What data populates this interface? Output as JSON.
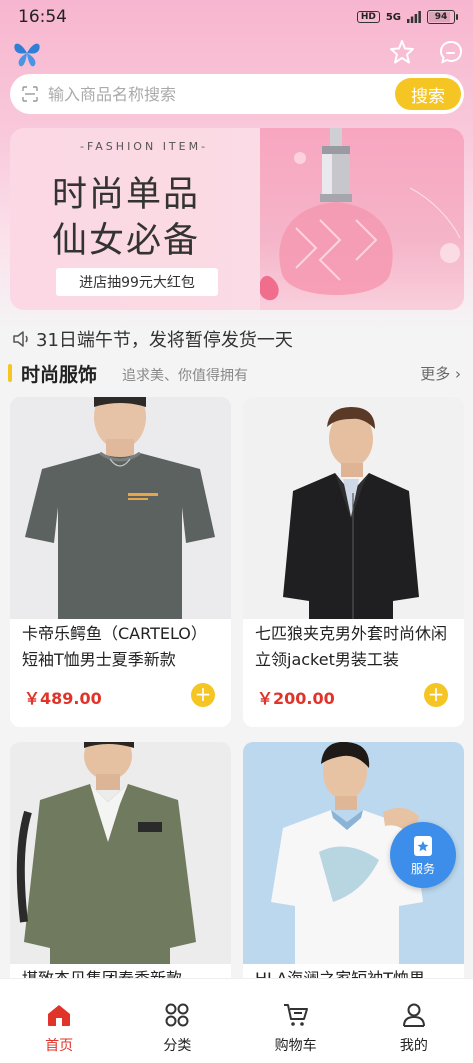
{
  "status_bar": {
    "time": "16:54",
    "network": "5G",
    "hd": "HD",
    "battery": "94"
  },
  "header": {
    "logo_icon": "butterfly-icon",
    "favorite_icon": "star-icon",
    "message_icon": "chat-icon"
  },
  "search": {
    "placeholder": "输入商品名称搜索",
    "button_label": "搜索",
    "scan_icon": "scan-icon"
  },
  "banner": {
    "subtitle": "-FASHION ITEM-",
    "title_line1": "时尚单品",
    "title_line2": "仙女必备",
    "cta": "进店抽99元大红包"
  },
  "notice": {
    "icon": "speaker-icon",
    "text": "31日端午节，发将暂停发货一天"
  },
  "section": {
    "title": "时尚服饰",
    "subtitle": "追求美、你值得拥有",
    "more": "更多"
  },
  "products": [
    {
      "name": "卡帝乐鳄鱼（CARTELO）短袖T恤男士夏季新款",
      "price": "￥489.00"
    },
    {
      "name": "七匹狼夹克男外套时尚休闲立领jacket男装工装",
      "price": "￥200.00"
    },
    {
      "name": "堪致杰贝集团春季新款",
      "price": ""
    },
    {
      "name": "HLA海澜之家短袖T恤男",
      "price": ""
    }
  ],
  "float_service": {
    "label": "服务",
    "icon": "service-icon"
  },
  "tabs": [
    {
      "label": "首页",
      "icon": "home-icon",
      "active": true
    },
    {
      "label": "分类",
      "icon": "grid-icon",
      "active": false
    },
    {
      "label": "购物车",
      "icon": "cart-icon",
      "active": false
    },
    {
      "label": "我的",
      "icon": "user-icon",
      "active": false
    }
  ],
  "colors": {
    "accent": "#f5c524",
    "price": "#e0342b",
    "header_pink": "#f7b6cf",
    "service_blue": "#3d8eea"
  }
}
